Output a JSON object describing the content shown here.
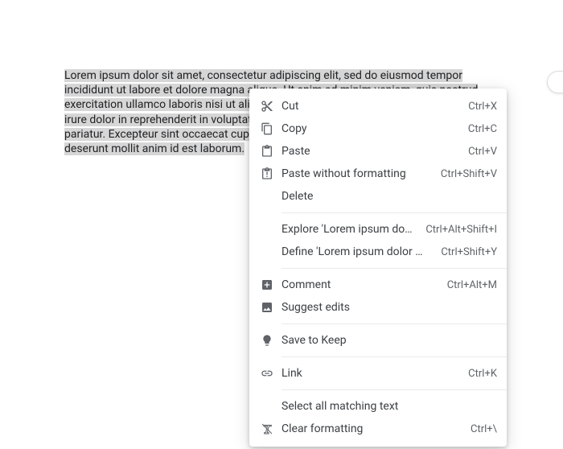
{
  "document": {
    "text": "Lorem ipsum dolor sit amet, consectetur adipiscing elit, sed do eiusmod tempor incididunt ut labore et dolore magna aliqua. Ut enim ad minim veniam, quis nostrud exercitation ullamco laboris nisi ut aliquip ex ea commodo consequat. Duis aute irure dolor in reprehenderit in voluptate velit esse cillum dolore eu fugiat nulla pariatur. Excepteur sint occaecat cupidatat non proident, sunt in culpa qui officia deserunt mollit anim id est laborum."
  },
  "menu": {
    "cut": {
      "label": "Cut",
      "shortcut": "Ctrl+X"
    },
    "copy": {
      "label": "Copy",
      "shortcut": "Ctrl+C"
    },
    "paste": {
      "label": "Paste",
      "shortcut": "Ctrl+V"
    },
    "paste_no_fmt": {
      "label": "Paste without formatting",
      "shortcut": "Ctrl+Shift+V"
    },
    "delete": {
      "label": "Delete"
    },
    "explore": {
      "label": "Explore 'Lorem ipsum dolor s…'",
      "shortcut": "Ctrl+Alt+Shift+I"
    },
    "define": {
      "label": "Define 'Lorem ipsum dolor s…'",
      "shortcut": "Ctrl+Shift+Y"
    },
    "comment": {
      "label": "Comment",
      "shortcut": "Ctrl+Alt+M"
    },
    "suggest": {
      "label": "Suggest edits"
    },
    "keep": {
      "label": "Save to Keep"
    },
    "link": {
      "label": "Link",
      "shortcut": "Ctrl+K"
    },
    "select_all_matching": {
      "label": "Select all matching text"
    },
    "clear_fmt": {
      "label": "Clear formatting",
      "shortcut": "Ctrl+\\"
    }
  }
}
